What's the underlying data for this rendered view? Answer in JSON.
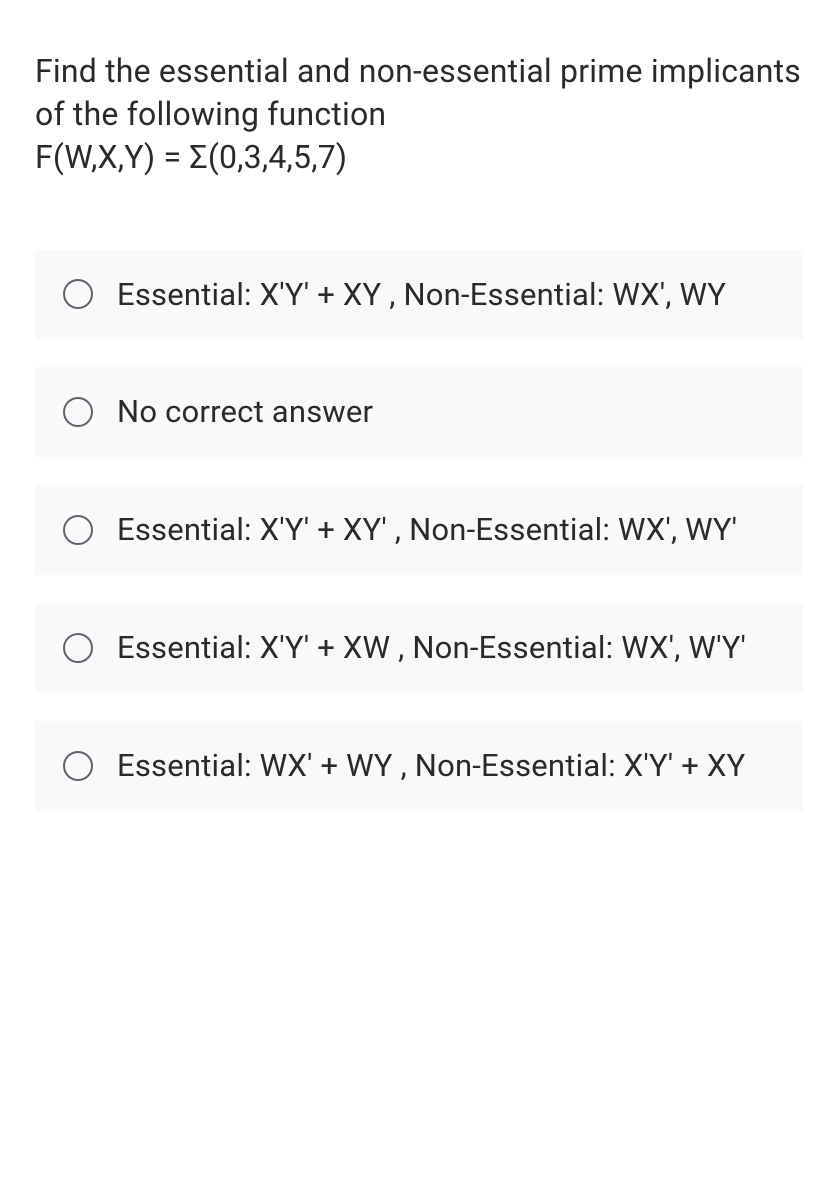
{
  "question": {
    "line1": "Find the essential and non-essential prime implicants of the following function",
    "line2": "F(W,X,Y) =  Σ(0,3,4,5,7)"
  },
  "options": [
    {
      "text": "Essential: X'Y' + XY , Non-Essential: WX', WY"
    },
    {
      "text": "No correct answer"
    },
    {
      "text": "Essential: X'Y' + XY' , Non-Essential: WX', WY'"
    },
    {
      "text": "Essential: X'Y' + XW , Non-Essential: WX', W'Y'"
    },
    {
      "text": "Essential: WX' + WY , Non-Essential: X'Y' + XY"
    }
  ]
}
